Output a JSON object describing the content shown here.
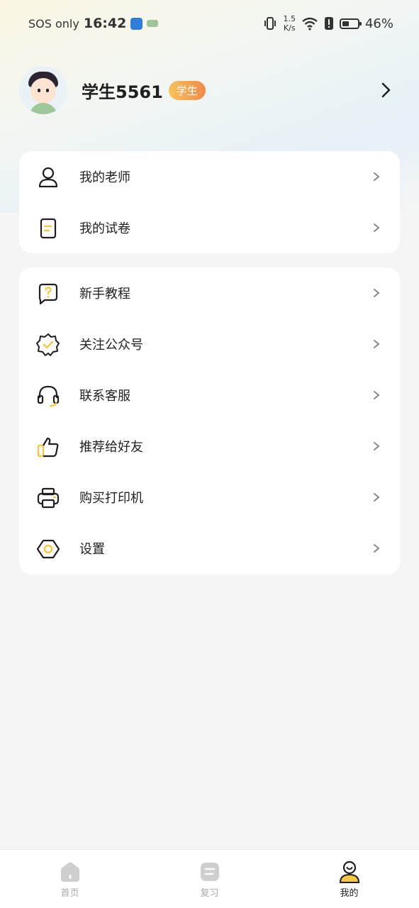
{
  "status_bar": {
    "carrier": "SOS only",
    "time": "16:42",
    "net_speed_value": "1.5",
    "net_speed_unit": "K/s",
    "battery_text": "46%",
    "battery_level": 0.46
  },
  "profile": {
    "username": "学生5561",
    "role_badge": "学生"
  },
  "menu_group_1": [
    {
      "label": "我的老师",
      "icon": "user-icon"
    },
    {
      "label": "我的试卷",
      "icon": "paper-icon"
    }
  ],
  "menu_group_2": [
    {
      "label": "新手教程",
      "icon": "question-bubble-icon"
    },
    {
      "label": "关注公众号",
      "icon": "badge-check-icon"
    },
    {
      "label": "联系客服",
      "icon": "headset-icon"
    },
    {
      "label": "推荐给好友",
      "icon": "thumbs-up-icon"
    },
    {
      "label": "购买打印机",
      "icon": "printer-icon"
    },
    {
      "label": "设置",
      "icon": "settings-hexagon-icon"
    }
  ],
  "tab_bar": [
    {
      "label": "首页",
      "icon": "home-icon",
      "active": false
    },
    {
      "label": "复习",
      "icon": "review-icon",
      "active": false
    },
    {
      "label": "我的",
      "icon": "profile-icon",
      "active": true
    }
  ],
  "colors": {
    "accent": "#f5c842",
    "badge_start": "#f7c35a",
    "badge_end": "#f08a4b",
    "icon_stroke": "#1f1f1f"
  }
}
